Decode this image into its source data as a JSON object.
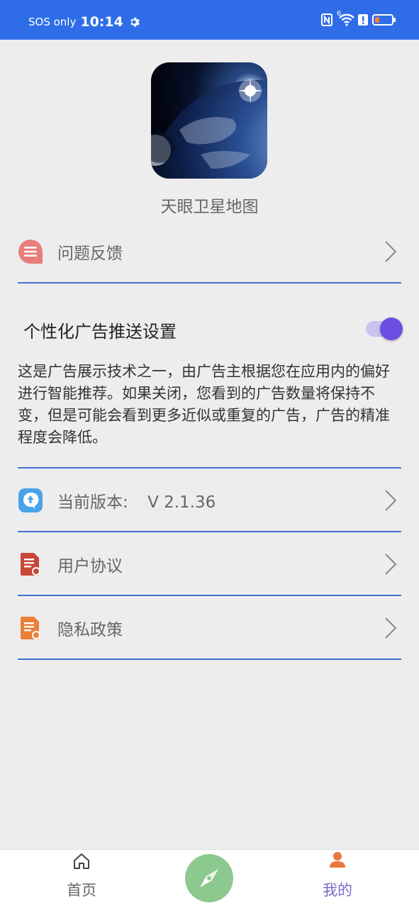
{
  "status_bar": {
    "carrier": "SOS only",
    "time": "10:14",
    "network_gen": "6"
  },
  "app": {
    "name": "天眼卫星地图"
  },
  "menu": {
    "feedback": "问题反馈",
    "version_label": "当前版本:",
    "version_value": "V 2.1.36",
    "user_agreement": "用户协议",
    "privacy_policy": "隐私政策"
  },
  "ads": {
    "title": "个性化广告推送设置",
    "enabled": true,
    "description": "这是广告展示技术之一，由广告主根据您在应用内的偏好进行智能推荐。如果关闭，您看到的广告数量将保持不变，但是可能会看到更多近似或重复的广告，广告的精准程度会降低。"
  },
  "nav": {
    "home": "首页",
    "mine": "我的"
  },
  "colors": {
    "status_bar": "#2f6de8",
    "divider": "#3d73cf",
    "toggle_on": "#6c4ee3",
    "active_tab": "#7a6cc9",
    "compass_button": "#8bc98f"
  },
  "icons": {
    "feedback": "feedback-icon",
    "version": "version-icon",
    "agreement": "document-icon",
    "privacy": "privacy-icon",
    "home": "home-icon",
    "mine": "user-icon",
    "center": "compass-icon"
  }
}
